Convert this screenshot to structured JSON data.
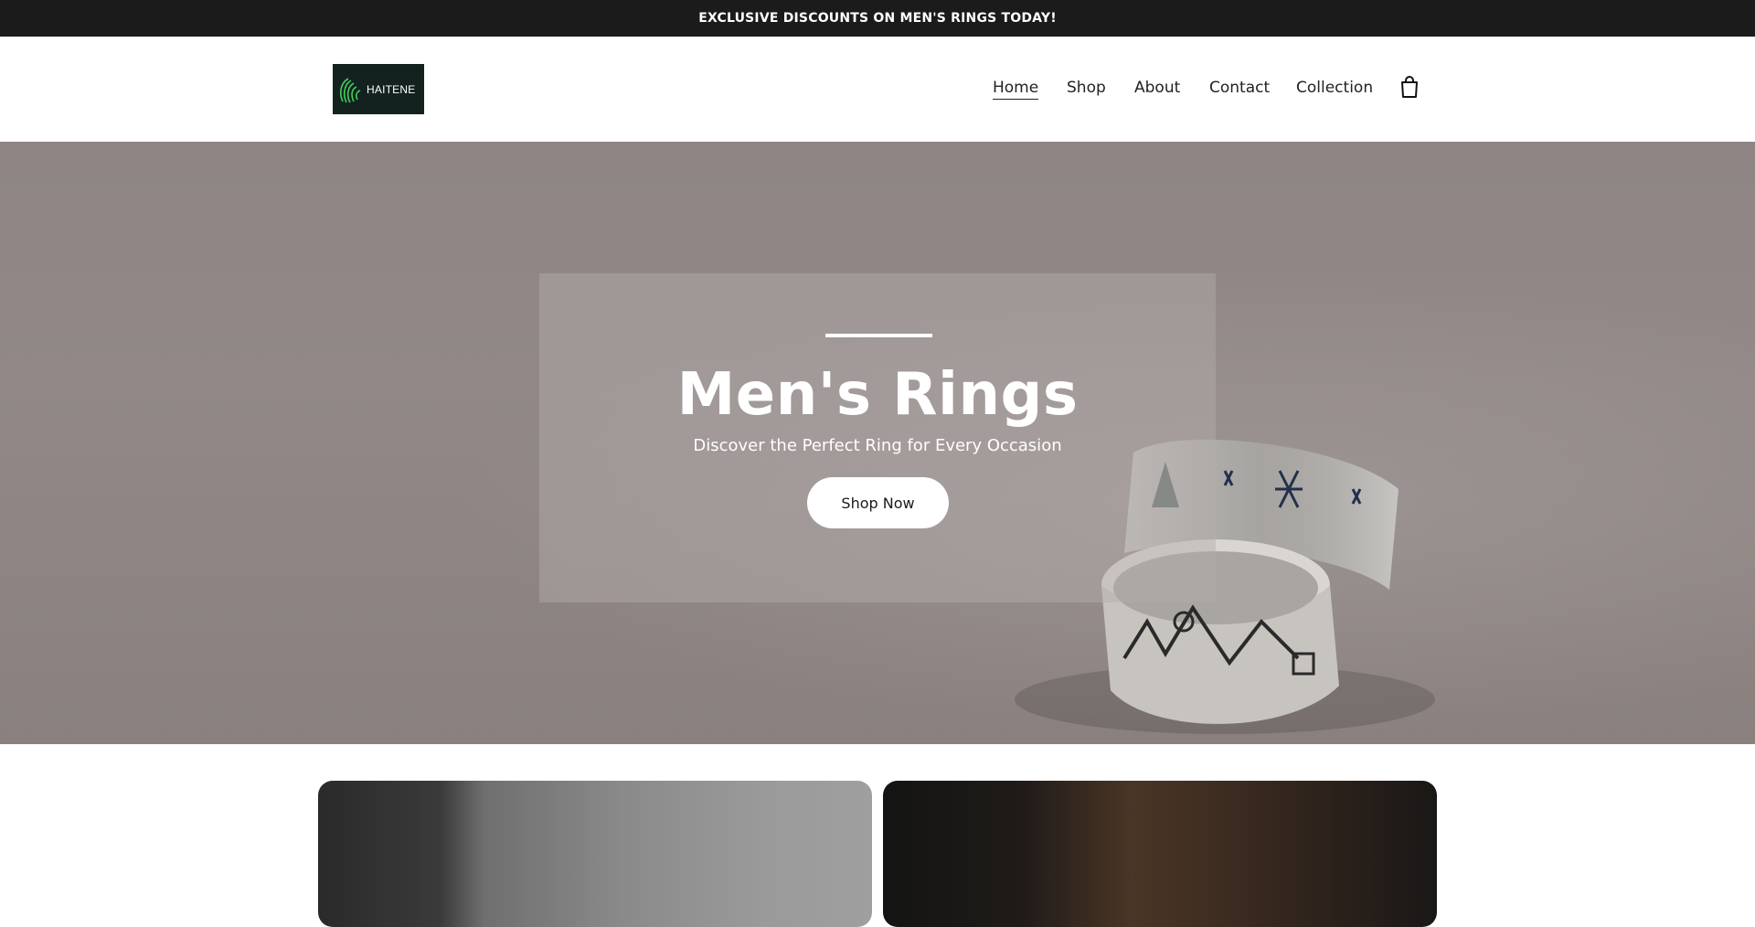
{
  "announcement": {
    "text": "EXCLUSIVE DISCOUNTS ON MEN'S RINGS TODAY!"
  },
  "header": {
    "logo_text": "HAITENE",
    "nav": [
      {
        "label": "Home",
        "active": true
      },
      {
        "label": "Shop",
        "active": false
      },
      {
        "label": "About",
        "active": false
      },
      {
        "label": "Contact",
        "active": false
      },
      {
        "label": "Collection",
        "active": false
      }
    ],
    "cart_icon": "shopping-bag-icon"
  },
  "hero": {
    "title": "Men's Rings",
    "subtitle": "Discover the Perfect Ring for Every Occasion",
    "button_label": "Shop Now"
  },
  "colors": {
    "announcement_bg": "#1b1b1b",
    "logo_bg": "#13221f",
    "logo_accent": "#3fcf5a"
  }
}
